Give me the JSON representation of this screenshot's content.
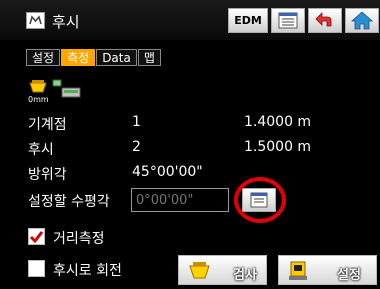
{
  "window": {
    "title": "후시"
  },
  "toolbar": {
    "edm_label": "EDM"
  },
  "tabs": [
    {
      "label": "설정",
      "active": false
    },
    {
      "label": "측정",
      "active": true
    },
    {
      "label": "Data",
      "active": false
    },
    {
      "label": "맵",
      "active": false
    }
  ],
  "status": {
    "unit": "0mm"
  },
  "rows": {
    "instrument": {
      "label": "기계점",
      "point": "1",
      "height": "1.4000 m"
    },
    "backsight": {
      "label": "후시",
      "point": "2",
      "height": "1.5000 m"
    },
    "azimuth": {
      "label": "방위각",
      "value": "45°00'00\""
    }
  },
  "set_angle": {
    "label": "설정할 수평각",
    "placeholder": "0°00'00\""
  },
  "checks": {
    "distance": {
      "label": "거리측정",
      "checked": true
    },
    "rotate": {
      "label": "후시로 회전",
      "checked": false
    }
  },
  "buttons": {
    "inspect": "검사",
    "setup": "설정"
  },
  "colors": {
    "tab_active": "#ffa600",
    "highlight": "#e10000",
    "check": "#d40000"
  }
}
